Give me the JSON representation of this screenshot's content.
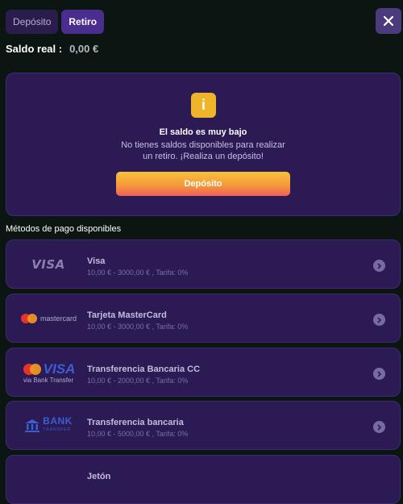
{
  "tabs": [
    {
      "label": "Depósito",
      "active": false
    },
    {
      "label": "Retiro",
      "active": true
    }
  ],
  "balance": {
    "label": "Saldo real :",
    "value": "0,00 €"
  },
  "notice": {
    "icon": "info-icon",
    "icon_glyph": "i",
    "title": "El saldo es muy bajo",
    "line1": "No tienes saldos disponibles para realizar",
    "line2": "un retiro. ¡Realiza un depósito!",
    "button": "Depósito"
  },
  "methods_title": "Métodos de pago disponibles",
  "methods": [
    {
      "name": "Visa",
      "range": "10,00 € - 3000,00 € , Tarifa: 0%",
      "logo": "visa-logo",
      "logo_text": "VISA"
    },
    {
      "name": "Tarjeta MasterCard",
      "range": "10,00 € - 3000,00 € , Tarifa: 0%",
      "logo": "mastercard-logo",
      "logo_text": "mastercard"
    },
    {
      "name": "Transferencia Bancaria CC",
      "range": "10,00 € - 2000,00 € , Tarifa: 0%",
      "logo": "visa-bank-transfer-logo",
      "logo_text": "VISA",
      "logo_sub": "via Bank Transfer"
    },
    {
      "name": "Transferencia bancaria",
      "range": "10,00 € - 5000,00 € , Tarifa: 0%",
      "logo": "bank-transfer-logo",
      "logo_text": "BANK",
      "logo_sub": "TRANSFER"
    },
    {
      "name": "Jetón",
      "range": "",
      "logo": "jeton-logo",
      "logo_text": ""
    }
  ],
  "colors": {
    "background": "#0b1512",
    "card": "#2c1a55",
    "accent": "#4b2c8f",
    "warning": "#f0b429"
  }
}
